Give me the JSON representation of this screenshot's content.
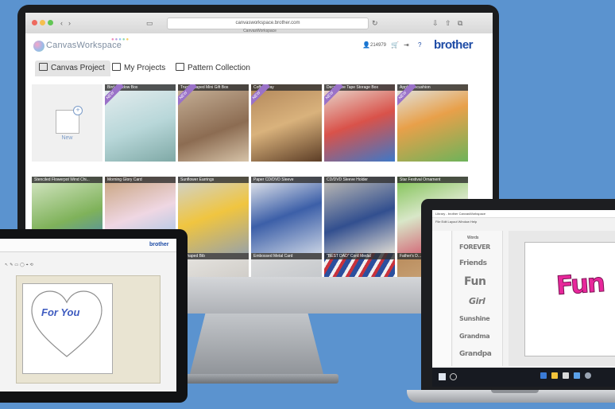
{
  "imac": {
    "browser": {
      "url": "canvasworkspace.brother.com",
      "tab_title": "CanvasWorkspace"
    },
    "app": {
      "logo_text": "CanvasWorkspace",
      "user_id": "214979",
      "brand": "brother"
    },
    "tabs": [
      {
        "label": "Canvas Project"
      },
      {
        "label": "My Projects"
      },
      {
        "label": "Pattern Collection"
      }
    ],
    "new_card_label": "New",
    "new_badge": "NEW",
    "projects": [
      {
        "title": "Bird Shadow Box",
        "is_new": true
      },
      {
        "title": "Trunk-shaped Mini Gift Box",
        "is_new": true
      },
      {
        "title": "Coffee Tray",
        "is_new": true
      },
      {
        "title": "Decorative Tape Storage Box",
        "is_new": true
      },
      {
        "title": "Apple Pincushion",
        "is_new": true
      },
      {
        "title": "Stenciled Flowerpot Wind Chi...",
        "is_new": false
      },
      {
        "title": "Morning Glory Card",
        "is_new": false
      },
      {
        "title": "Sunflower Earrings",
        "is_new": false
      },
      {
        "title": "Paper CD/DVD Sleeve",
        "is_new": false
      },
      {
        "title": "CD/DVD Sleeve Holder",
        "is_new": false
      },
      {
        "title": "Star Festival Ornament",
        "is_new": false
      },
      {
        "title": "...-shaped Bib",
        "is_new": false
      },
      {
        "title": "Embossed Metal Card",
        "is_new": false
      },
      {
        "title": "\"BEST DAD\" Cord Medal",
        "is_new": false
      },
      {
        "title": "Father's D...",
        "is_new": false
      }
    ]
  },
  "tablet": {
    "brand": "brother",
    "canvas_text": "For You"
  },
  "laptop": {
    "window_title": "Library - brother CanvasWorkspace",
    "menu": "File  Edit  Layout  Window  Help",
    "panel_title": "Words",
    "words": [
      "FOREVER",
      "Friends",
      "Fun",
      "Girl",
      "Sunshine",
      "Grandma",
      "Grandpa"
    ],
    "canvas_text": "Fun"
  }
}
